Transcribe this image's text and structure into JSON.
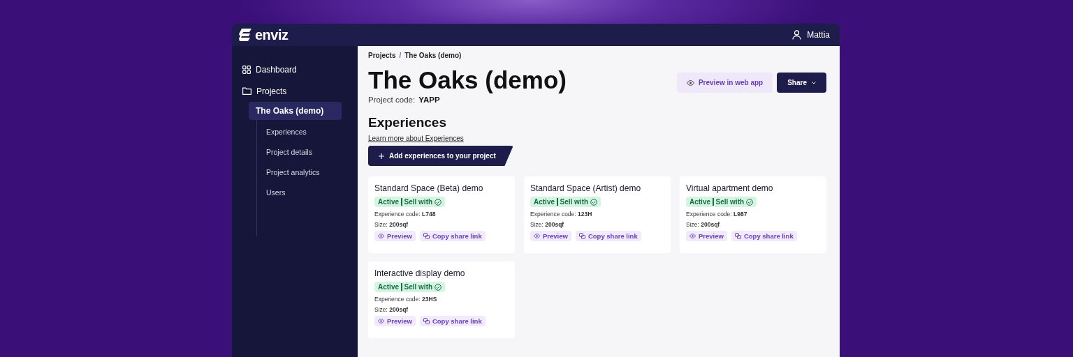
{
  "app": {
    "logo": "enviz",
    "user": "Mattia"
  },
  "sidebar": {
    "items": [
      {
        "label": "Dashboard",
        "kind": "grid",
        "selected": false
      },
      {
        "label": "Projects",
        "kind": "folder",
        "selected": false,
        "children": [
          {
            "label": "The Oaks (demo)",
            "selected": true,
            "children": [
              {
                "label": "Experiences",
                "selected": false
              },
              {
                "label": "Project details",
                "selected": false
              },
              {
                "label": "Project analytics",
                "selected": false
              },
              {
                "label": "Users",
                "selected": false
              }
            ]
          }
        ]
      }
    ]
  },
  "breadcrumb": {
    "items": [
      "Projects",
      "The Oaks (demo)"
    ],
    "separator": "/"
  },
  "page": {
    "title": "The Oaks (demo)",
    "code_label": "Project code:",
    "code": "YAPP",
    "preview_button": "Preview in web app",
    "share_button": "Share"
  },
  "section": {
    "title": "Experiences",
    "link": "Learn more about Experiences",
    "add_button": "Add experiences to your project"
  },
  "experiences": [
    {
      "title": "Standard Space (Beta) demo",
      "status": "Active",
      "tag": "Sell with",
      "code": "Experience code: **L748**",
      "size": "Size: **200sqf**",
      "preview": "Preview",
      "copy": "Copy share link"
    },
    {
      "title": "Standard Space (Artist) demo",
      "status": "Active",
      "tag": "Sell with",
      "code": "Experience code: **123H**",
      "size": "Size: **200sqf**",
      "preview": "Preview",
      "copy": "Copy share link"
    },
    {
      "title": "Virtual apartment demo",
      "status": "Active",
      "tag": "Sell with",
      "code": "Experience code: **L987**",
      "size": "Size: **200sqf**",
      "preview": "Preview",
      "copy": "Copy share link"
    },
    {
      "title": "Interactive display demo",
      "status": "Active",
      "tag": "Sell with",
      "code": "Experience code: **23HS**",
      "size": "Size: **200sqf**",
      "preview": "Preview",
      "copy": "Copy share link"
    }
  ]
}
